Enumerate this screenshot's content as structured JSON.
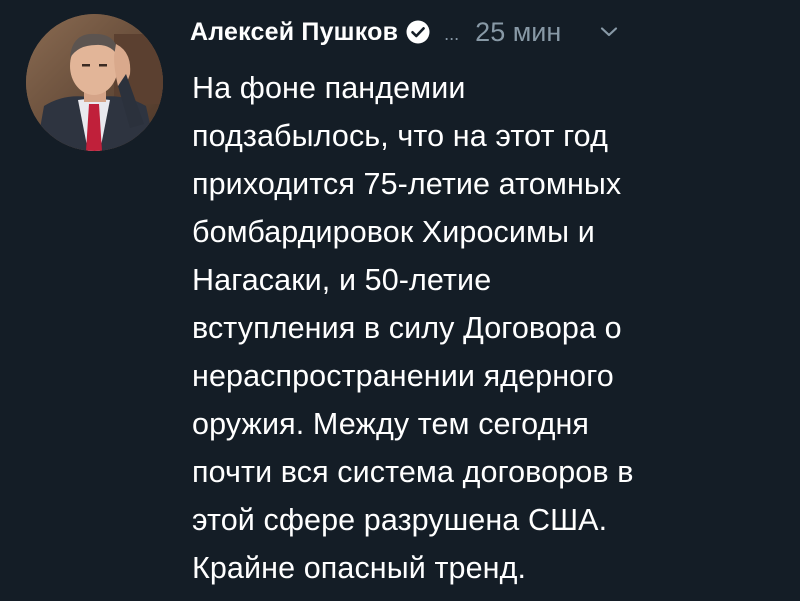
{
  "tweet": {
    "author_name": "Алексей Пушков",
    "handle_truncated": "...",
    "time": "25 мин",
    "icons": {
      "verified": "verified-badge-icon",
      "menu": "chevron-down-icon"
    },
    "colors": {
      "background": "#141d26",
      "text": "#ffffff",
      "muted": "#8899a6"
    },
    "body_lines": [
      "На фоне пандемии",
      "подзабылось, что на этот год",
      "приходится 75-летие атомных",
      "бомбардировок Хиросимы и",
      "Нагасаки, и 50-летие",
      "вступления в силу Договора о",
      "нераспространении ядерного",
      "оружия. Между тем сегодня",
      "почти вся система договоров в",
      "этой сфере разрушена США.",
      "Крайне опасный тренд."
    ]
  }
}
